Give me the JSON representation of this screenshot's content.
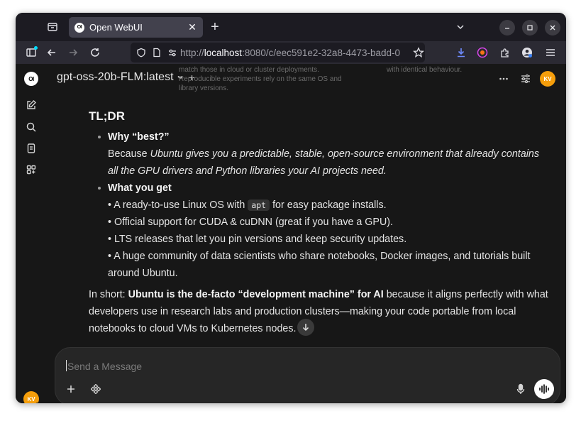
{
  "browser": {
    "tab": {
      "favicon_text": "OI",
      "title": "Open WebUI"
    },
    "url": {
      "protocol": "http://",
      "host": "localhost",
      "path": ":8080/c/eec591e2-32a8-4473-badd-0"
    },
    "window_controls": [
      "minimize",
      "maximize",
      "close"
    ]
  },
  "app": {
    "logo_text": "OI",
    "model_name": "gpt-oss-20b-FLM:latest",
    "user_initials": "KV",
    "ghost_text_left": "match those in cloud or cluster deployments.\nReproducible experiments rely on the same OS and\nlibrary versions.",
    "ghost_text_right": "with identical behaviour."
  },
  "message": {
    "heading": "TL;DR",
    "item1": {
      "title": "Why “best?”",
      "pre": "Because ",
      "emph": "Ubuntu gives you a predictable, stable, open-source environment that already contains all the GPU drivers and Python libraries your AI projects need."
    },
    "item2": {
      "title": "What you get",
      "line1_pre": "• A ready-to-use Linux OS with ",
      "line1_code": "apt",
      "line1_post": " for easy package installs.",
      "line2": "• Official support for CUDA & cuDNN (great if you have a GPU).",
      "line3": "• LTS releases that let you pin versions and keep security updates.",
      "line4": "• A huge community of data scientists who share notebooks, Docker images, and tutorials built around Ubuntu."
    },
    "summary": {
      "pre": "In short: ",
      "bold": "Ubuntu is the de-facto “development machine” for AI",
      "post": " because it aligns perfectly with what developers use in research labs and production clusters—making your code portable from local notebooks to cloud VMs to Kubernetes nodes."
    }
  },
  "composer": {
    "placeholder": "Send a Message"
  },
  "colors": {
    "accent_avatar": "#f59e0b",
    "online": "#22c55e",
    "background": "#171717"
  }
}
